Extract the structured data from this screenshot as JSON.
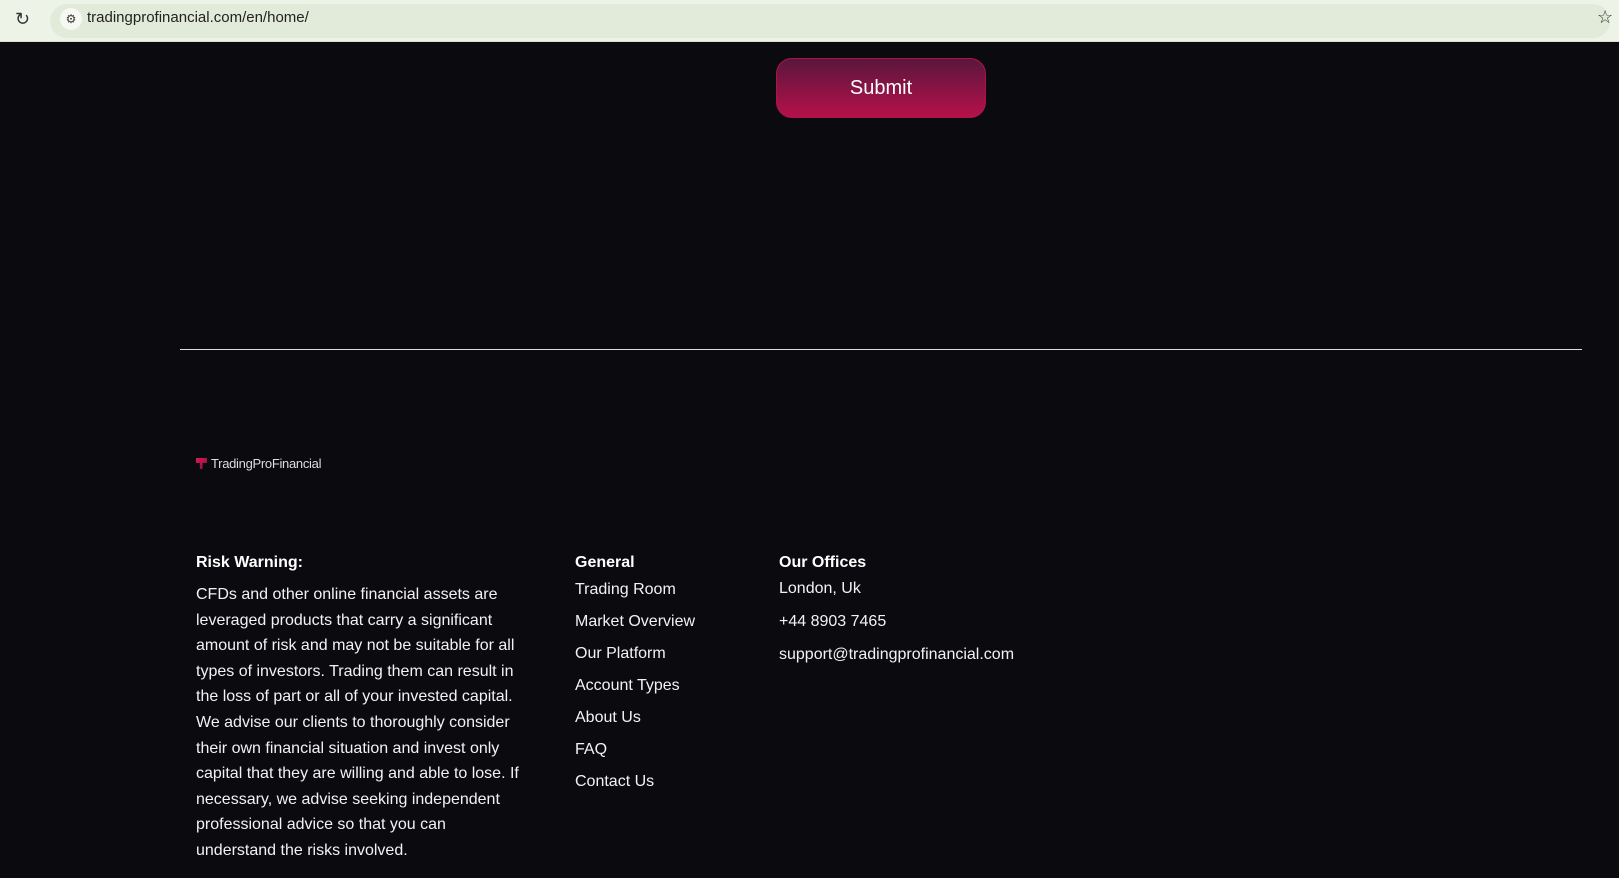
{
  "browser": {
    "url": "tradingprofinancial.com/en/home/"
  },
  "form": {
    "submit_label": "Submit"
  },
  "footer": {
    "logo_text": "TradingProFinancial",
    "risk": {
      "title": "Risk Warning:",
      "text": "CFDs and other online financial assets are leveraged products that carry a significant amount of risk and may not be suitable for all types of investors. Trading them can result in the loss of part or all of your invested capital. We advise our clients to thoroughly consider their own financial situation and invest only capital that they are willing and able to lose. If necessary, we advise seeking independent professional advice so that you can understand the risks involved."
    },
    "general": {
      "title": "General",
      "links": [
        "Trading Room",
        "Market Overview",
        "Our Platform",
        "Account Types",
        "About Us",
        "FAQ",
        "Contact Us"
      ]
    },
    "offices": {
      "title": "Our Offices",
      "location": "London, Uk",
      "phone": "+44 8903 7465",
      "email": "support@tradingprofinancial.com"
    }
  }
}
